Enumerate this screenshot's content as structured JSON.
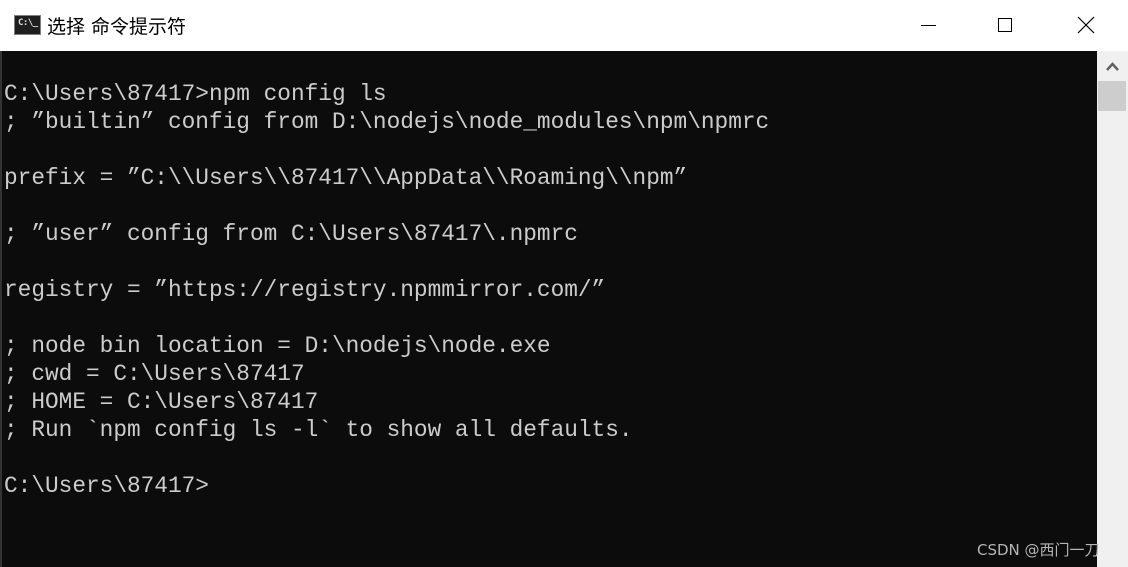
{
  "window": {
    "title": "选择 命令提示符",
    "icon": "cmd-icon",
    "icon_label": "C:\\_",
    "controls": {
      "minimize": "minimize-icon",
      "maximize": "maximize-icon",
      "close": "close-icon"
    }
  },
  "console": {
    "lines": [
      "C:\\Users\\87417>npm config ls",
      "; ”builtin” config from D:\\nodejs\\node_modules\\npm\\npmrc",
      "",
      "prefix = ”C:\\\\Users\\\\87417\\\\AppData\\\\Roaming\\\\npm”",
      "",
      "; ”user” config from C:\\Users\\87417\\.npmrc",
      "",
      "registry = ”https://registry.npmmirror.com/”",
      "",
      "; node bin location = D:\\nodejs\\node.exe",
      "; cwd = C:\\Users\\87417",
      "; HOME = C:\\Users\\87417",
      "; Run `npm config ls -l` to show all defaults.",
      "",
      "C:\\Users\\87417>"
    ]
  },
  "watermark": "CSDN @西门一刀",
  "colors": {
    "console_bg": "#0c0c0c",
    "console_text": "#cccccc",
    "titlebar_bg": "#ffffff"
  }
}
